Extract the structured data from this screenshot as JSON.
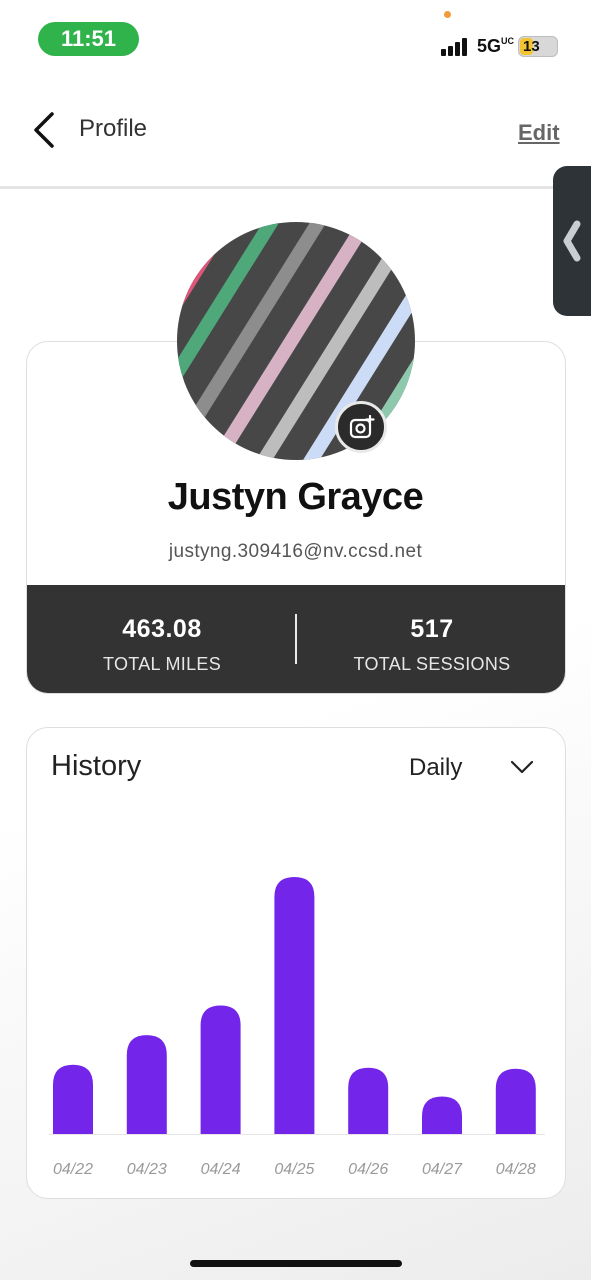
{
  "status_bar": {
    "time": "11:51",
    "network": "5G",
    "network_superscript": "UC",
    "battery": "13"
  },
  "header": {
    "title": "Profile",
    "edit_label": "Edit"
  },
  "profile": {
    "name": "Justyn Grayce",
    "email": "justyng.309416@nv.ccsd.net",
    "stats": [
      {
        "value": "463.08",
        "label": "TOTAL MILES"
      },
      {
        "value": "517",
        "label": "TOTAL SESSIONS"
      }
    ]
  },
  "history": {
    "title": "History",
    "period": "Daily"
  },
  "chart_data": {
    "type": "bar",
    "categories": [
      "04/22",
      "04/23",
      "04/24",
      "04/25",
      "04/26",
      "04/27",
      "04/28"
    ],
    "values": [
      7,
      10,
      13,
      26,
      6.7,
      3.8,
      6.6
    ],
    "title": "",
    "xlabel": "",
    "ylabel": "",
    "ylim": [
      0,
      26
    ],
    "bar_color": "#7326ea",
    "grid": false
  },
  "colors": {
    "bar": "#7326ea",
    "stats_bar": "#333333",
    "time_pill": "#2fb34a",
    "side_tab": "#2e3338"
  },
  "icons": {
    "back": "chevron-left-icon",
    "camera": "camera-plus-icon",
    "dropdown": "chevron-down-icon",
    "side_tab": "chevron-left-icon"
  }
}
